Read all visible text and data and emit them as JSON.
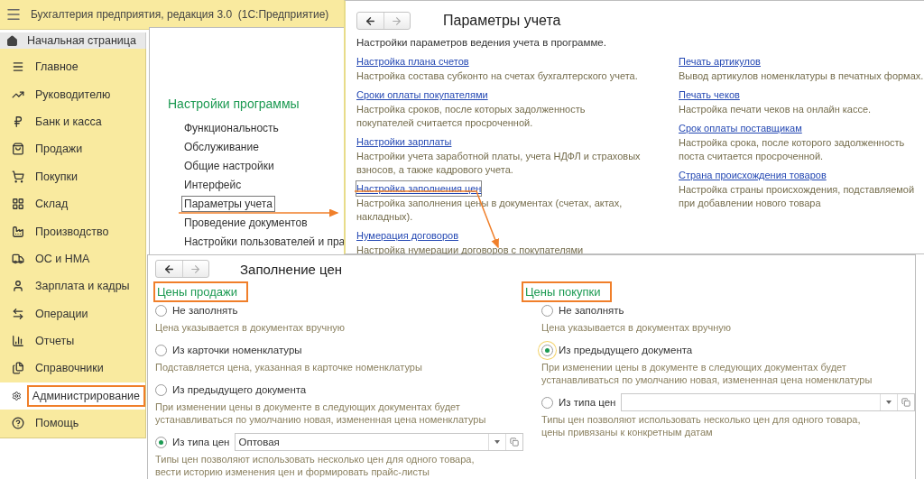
{
  "app": {
    "title": "Бухгалтерия предприятия, редакция 3.0  (1С:Предприятие)"
  },
  "home_tab": {
    "label": "Начальная страница"
  },
  "sidebar": {
    "items": [
      {
        "label": "Главное",
        "selected": false,
        "highlighted": false
      },
      {
        "label": "Руководителю",
        "selected": false,
        "highlighted": false
      },
      {
        "label": "Банк и касса",
        "selected": false,
        "highlighted": false
      },
      {
        "label": "Продажи",
        "selected": false,
        "highlighted": false
      },
      {
        "label": "Покупки",
        "selected": false,
        "highlighted": false
      },
      {
        "label": "Склад",
        "selected": false,
        "highlighted": false
      },
      {
        "label": "Производство",
        "selected": false,
        "highlighted": false
      },
      {
        "label": "ОС и НМА",
        "selected": false,
        "highlighted": false
      },
      {
        "label": "Зарплата и кадры",
        "selected": false,
        "highlighted": false
      },
      {
        "label": "Операции",
        "selected": false,
        "highlighted": false
      },
      {
        "label": "Отчеты",
        "selected": false,
        "highlighted": false
      },
      {
        "label": "Справочники",
        "selected": false,
        "highlighted": false
      },
      {
        "label": "Администрирование",
        "selected": true,
        "highlighted": true
      },
      {
        "label": "Помощь",
        "selected": false,
        "highlighted": false
      }
    ]
  },
  "settings_panel": {
    "heading": "Настройки программы",
    "items": [
      {
        "label": "Функциональность",
        "selected": false
      },
      {
        "label": "Обслуживание",
        "selected": false
      },
      {
        "label": "Общие настройки",
        "selected": false
      },
      {
        "label": "Интерфейс",
        "selected": false
      },
      {
        "label": "Параметры учета",
        "selected": true
      },
      {
        "label": "Проведение документов",
        "selected": false
      },
      {
        "label": "Настройки пользователей и пра",
        "selected": false
      }
    ]
  },
  "accounting_window": {
    "title": "Параметры учета",
    "subtitle": "Настройки параметров ведения учета в программе.",
    "columns": [
      [
        {
          "link": "Настройка плана счетов",
          "description": "Настройка состава субконто на счетах бухгалтерского учета.",
          "focused": false
        },
        {
          "link": "Сроки оплаты покупателями",
          "description": "Настройка сроков, после которых задолженность покупателей считается просроченной.",
          "focused": false
        },
        {
          "link": "Настройки зарплаты",
          "description": "Настройки учета заработной платы, учета НДФЛ и страховых взносов, а также кадрового учета.",
          "focused": false
        },
        {
          "link": "Настройка заполнения цен",
          "description": "Настройка заполнения цены в документах (счетах, актах, накладных).",
          "focused": true
        },
        {
          "link": "Нумерация договоров",
          "description": "Настройка нумерации договоров с покупателями",
          "focused": false
        }
      ],
      [
        {
          "link": "Печать артикулов",
          "description": "Вывод артикулов номенклатуры в печатных формах.",
          "focused": false
        },
        {
          "link": "Печать чеков",
          "description": "Настройка печати чеков на онлайн кассе.",
          "focused": false
        },
        {
          "link": "Срок оплаты поставщикам",
          "description": "Настройка срока, после которого задолженность поста считается просроченной.",
          "focused": false
        },
        {
          "link": "Страна происхождения товаров",
          "description": "Настройка страны происхождения, подставляемой при добавлении нового товара",
          "focused": false
        }
      ]
    ]
  },
  "prices_window": {
    "title": "Заполнение цен",
    "groups": [
      {
        "heading": "Цены продажи",
        "highlighted": true,
        "options": [
          {
            "kind": "plain",
            "label": "Не заполнять",
            "description": "Цена указывается в документах вручную",
            "selected": false,
            "focused": false
          },
          {
            "kind": "plain",
            "label": "Из карточки номенклатуры",
            "description": "Подставляется цена, указанная в карточке номенклатуры",
            "selected": false,
            "focused": false
          },
          {
            "kind": "plain",
            "label": "Из предыдущего документа",
            "description": "При изменении цены в документе в следующих документах будет устанавливаться по умолчанию новая, измененная цена номенклатуры",
            "selected": false,
            "focused": false
          },
          {
            "kind": "select",
            "label": "Из типа цен",
            "value": "Оптовая",
            "description": "Типы цен позволяют использовать несколько цен для одного товара, вести историю изменения цен и формировать прайс-листы",
            "selected": true,
            "focused": false
          }
        ]
      },
      {
        "heading": "Цены покупки",
        "highlighted": true,
        "options": [
          {
            "kind": "plain",
            "label": "Не заполнять",
            "description": "Цена указывается в документах вручную",
            "selected": false,
            "focused": false
          },
          {
            "kind": "plain",
            "label": "Из предыдущего документа",
            "description": "При изменении цены в документе в следующих документах будет устанавливаться по умолчанию новая, измененная цена номенклатуры",
            "selected": true,
            "focused": true
          },
          {
            "kind": "select",
            "label": "Из типа цен",
            "description": "Типы цен позволяют использовать несколько цен для одного товара, цены привязаны к конкретным датам",
            "selected": false,
            "focused": false
          }
        ]
      }
    ]
  }
}
